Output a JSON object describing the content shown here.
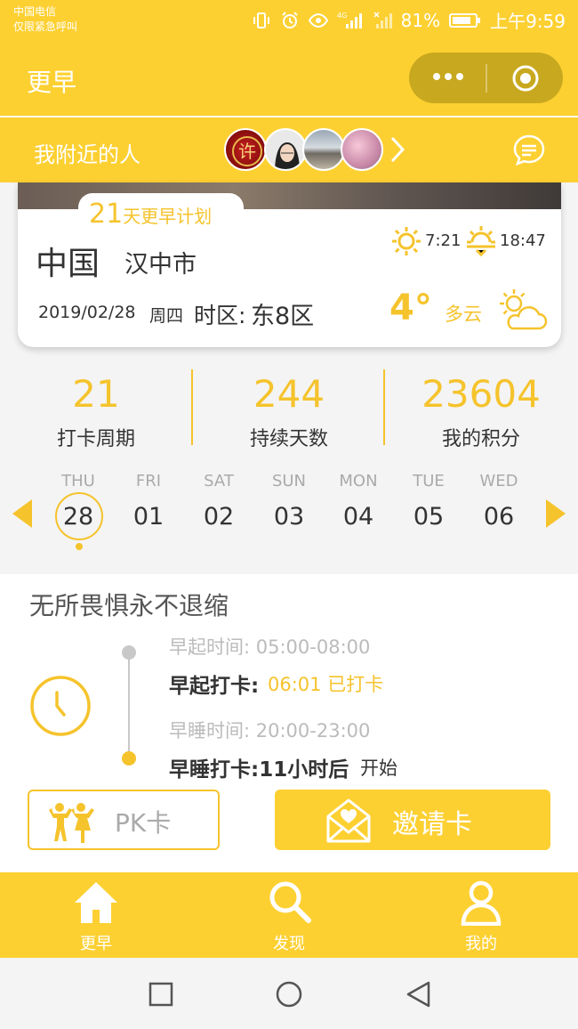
{
  "status_bar": {
    "carrier_line1": "中国电信",
    "carrier_line2": "仅限紧急呼叫",
    "battery": "81%",
    "time": "上午9:59"
  },
  "app_bar": {
    "title": "更早"
  },
  "nearby": {
    "label": "我附近的人",
    "avatar_char": "许"
  },
  "location_card": {
    "plan_number": "21",
    "plan_text": "天更早计划",
    "country": "中国",
    "city": "汉中市",
    "sunrise": "7:21",
    "sunset": "18:47",
    "date": "2019/02/28",
    "weekday": "周四",
    "timezone_label": "时区:",
    "timezone_value": "东8区",
    "temperature": "4°",
    "weather": "多云"
  },
  "stats": [
    {
      "value": "21",
      "label": "打卡周期"
    },
    {
      "value": "244",
      "label": "持续天数"
    },
    {
      "value": "23604",
      "label": "我的积分"
    }
  ],
  "week": [
    {
      "name": "THU",
      "date": "28"
    },
    {
      "name": "FRI",
      "date": "01"
    },
    {
      "name": "SAT",
      "date": "02"
    },
    {
      "name": "SUN",
      "date": "03"
    },
    {
      "name": "MON",
      "date": "04"
    },
    {
      "name": "TUE",
      "date": "05"
    },
    {
      "name": "WED",
      "date": "06"
    }
  ],
  "checkin": {
    "motto": "无所畏惧永不退缩",
    "wake_time_label": "早起时间: 05:00-08:00",
    "wake_label": "早起打卡:",
    "wake_status": "06:01 已打卡",
    "sleep_time_label": "早睡时间: 20:00-23:00",
    "sleep_label": "早睡打卡:11小时后",
    "sleep_status": "开始"
  },
  "buttons": {
    "pk": "PK卡",
    "invite": "邀请卡"
  },
  "bottom_nav": [
    {
      "label": "更早",
      "icon": "home-icon"
    },
    {
      "label": "发现",
      "icon": "search-icon"
    },
    {
      "label": "我的",
      "icon": "user-icon"
    }
  ],
  "colors": {
    "brand_yellow": "#fdd032",
    "accent_yellow": "#f5c32c",
    "capsule": "#c8a81e"
  }
}
